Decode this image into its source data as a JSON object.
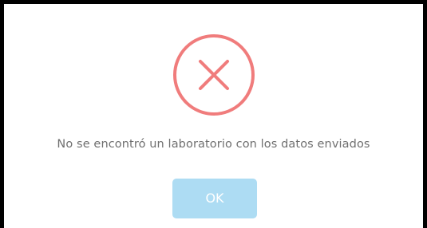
{
  "dialog": {
    "icon": "error-x-icon",
    "message": "No se encontró un laboratorio con los datos enviados",
    "confirm_label": "OK"
  },
  "colors": {
    "error_icon": "#f07c7c",
    "confirm_button": "#addcf3",
    "message_text": "#6f6f6f"
  }
}
